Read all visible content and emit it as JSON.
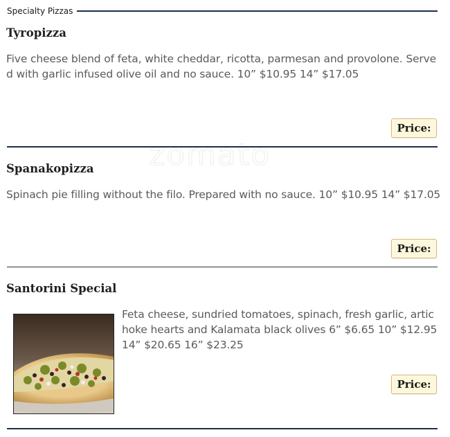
{
  "section": {
    "title": "Specialty Pizzas"
  },
  "watermark": "zomato",
  "items": [
    {
      "name": "Tyropizza",
      "description": "Five cheese blend of feta, white cheddar, ricotta, parmesan and provolone. Served with garlic infused olive oil and no sauce. 10” $10.95 14” $17.05",
      "price_label": "Price:"
    },
    {
      "name": "Spanakopizza",
      "description": "Spinach pie filling without the filo. Prepared with no sauce. 10” $10.95 14” $17.05",
      "price_label": "Price:"
    },
    {
      "name": "Santorini Special",
      "description": "Feta cheese, sundried tomatoes, spinach, fresh garlic, artichoke hearts and Kalamata black olives 6” $6.65 10” $12.95 14” $20.65 16” $23.25",
      "price_label": "Price:"
    }
  ]
}
